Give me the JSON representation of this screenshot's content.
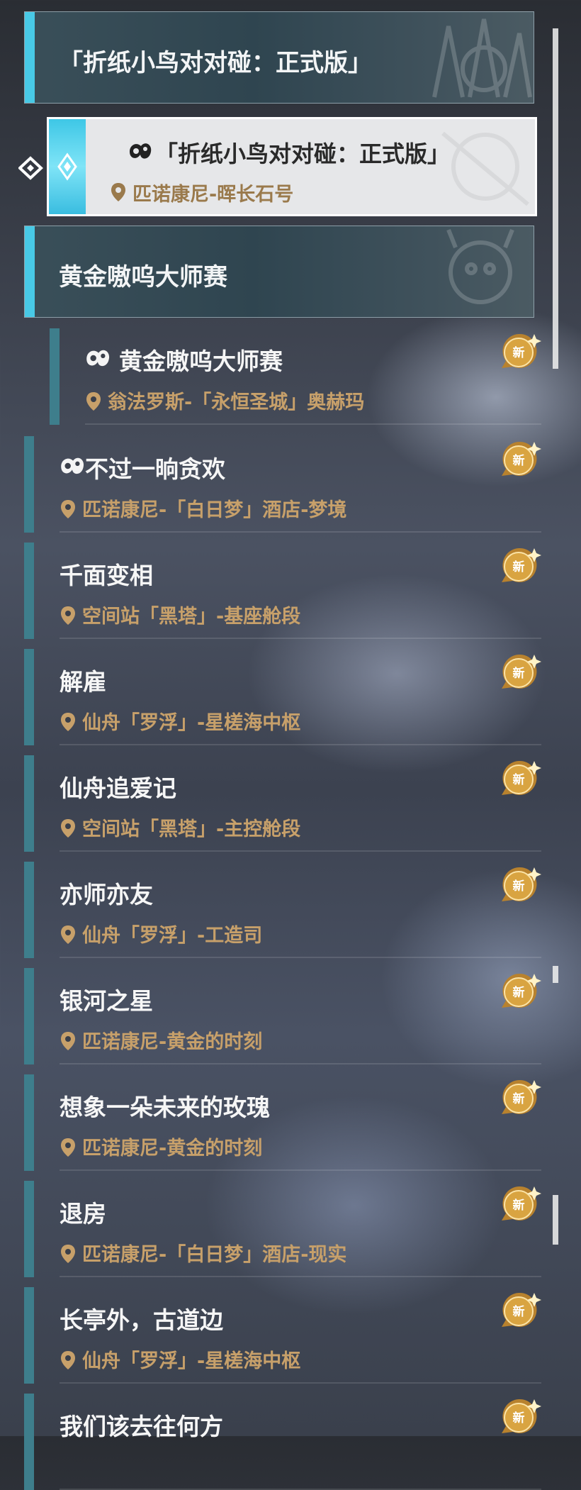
{
  "categories": [
    {
      "title": "「折纸小鸟对对碰：正式版」"
    },
    {
      "title": "黄金嗷呜大师赛"
    }
  ],
  "selected_quest": {
    "title": "「折纸小鸟对对碰：正式版」",
    "location": "匹诺康尼-晖长石号",
    "icon": "game-controller-icon"
  },
  "badge_label": "新",
  "quests": [
    {
      "title": "黄金嗷呜大师赛",
      "location": "翁法罗斯-「永恒圣城」奥赫玛",
      "icon": "game-controller-icon",
      "is_new": true
    },
    {
      "title": "不过一晌贪欢",
      "location": "匹诺康尼-「白日梦」酒店-梦境",
      "icon": "game-controller-icon",
      "is_new": true
    },
    {
      "title": "千面变相",
      "location": "空间站「黑塔」-基座舱段",
      "icon": "",
      "is_new": true
    },
    {
      "title": "解雇",
      "location": "仙舟「罗浮」-星槎海中枢",
      "icon": "",
      "is_new": true
    },
    {
      "title": "仙舟追爱记",
      "location": "空间站「黑塔」-主控舱段",
      "icon": "",
      "is_new": true
    },
    {
      "title": "亦师亦友",
      "location": "仙舟「罗浮」-工造司",
      "icon": "",
      "is_new": true
    },
    {
      "title": "银河之星",
      "location": "匹诺康尼-黄金的时刻",
      "icon": "",
      "is_new": true
    },
    {
      "title": "想象一朵未来的玫瑰",
      "location": "匹诺康尼-黄金的时刻",
      "icon": "",
      "is_new": true
    },
    {
      "title": "退房",
      "location": "匹诺康尼-「白日梦」酒店-现实",
      "icon": "",
      "is_new": true
    },
    {
      "title": "长亭外，古道边",
      "location": "仙舟「罗浮」-星槎海中枢",
      "icon": "",
      "is_new": true
    },
    {
      "title": "我们该去往何方",
      "location": "",
      "icon": "",
      "is_new": true
    }
  ],
  "colors": {
    "category_accent": "#48c9e6",
    "row_accent": "#3e7e8c",
    "location_text": "#c7a06a",
    "badge": "#d9a441"
  }
}
